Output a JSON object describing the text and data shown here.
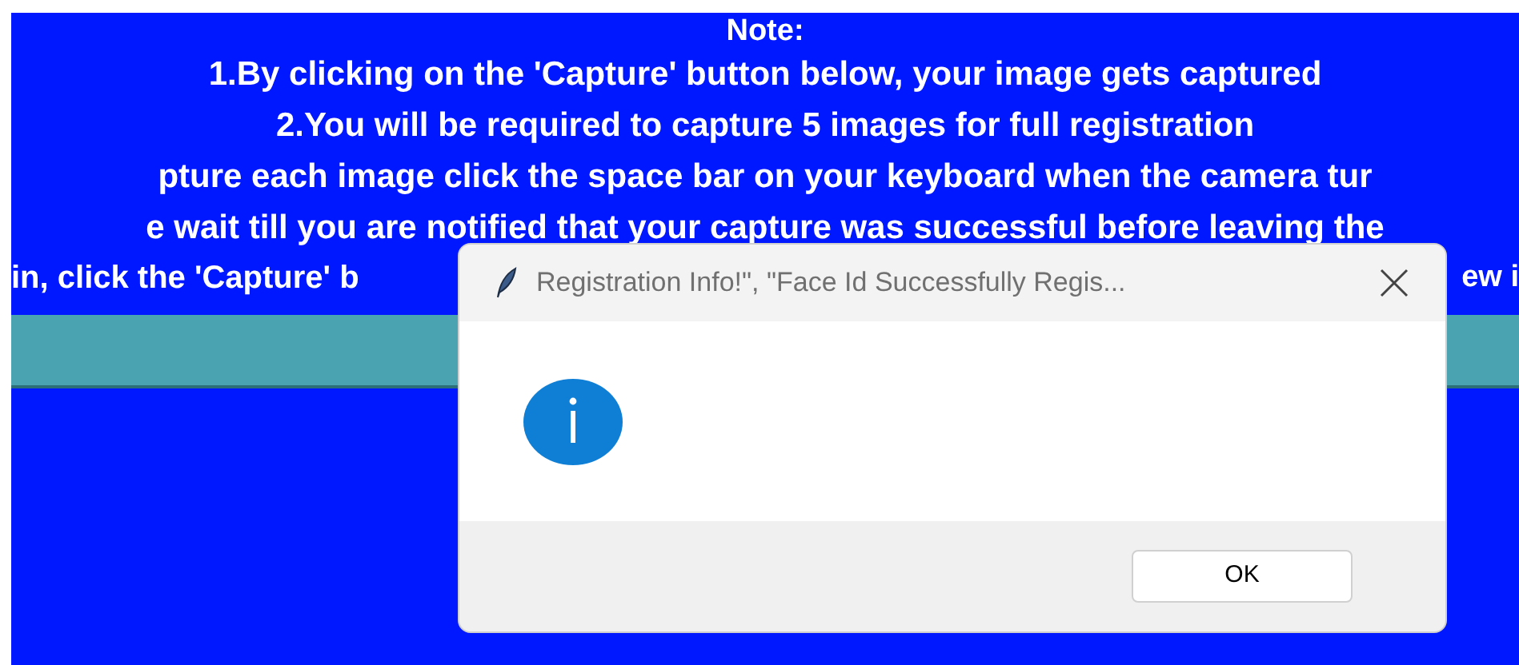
{
  "note": {
    "heading": "Note:",
    "lines": [
      "1.By clicking on the 'Capture' button below, your image gets captured",
      "2.You will be required to capture 5 images for full registration",
      "pture each image click the space bar on your keyboard when the camera tur",
      "e wait till you are notified that your capture was successful before leaving the"
    ],
    "last_line_left": "in, click the 'Capture' b",
    "last_line_right": "ew i"
  },
  "dialog": {
    "title": "Registration Info!\", \"Face Id Successfully Regis...",
    "kind": "info",
    "buttons": [
      "OK"
    ]
  }
}
